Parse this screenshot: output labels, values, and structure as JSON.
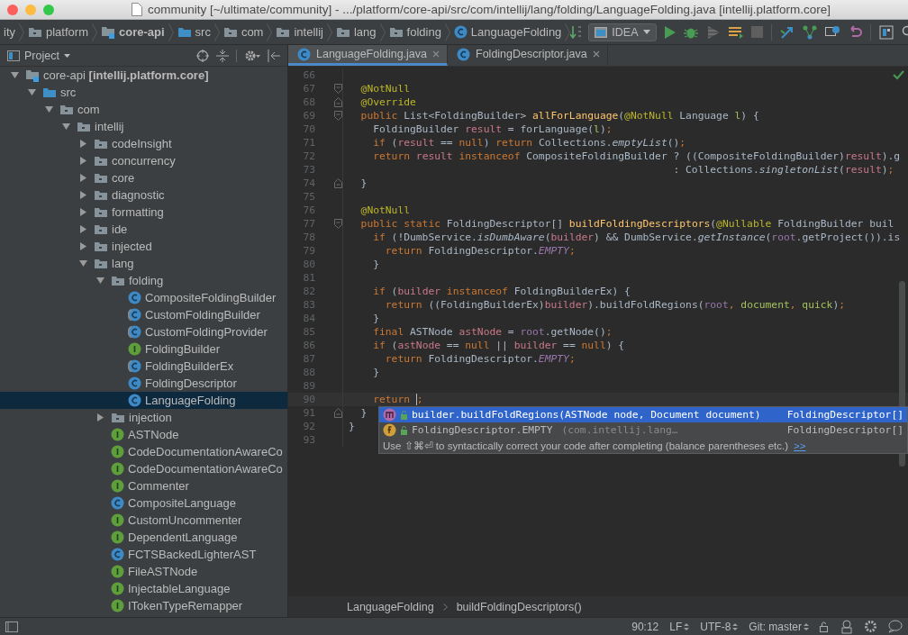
{
  "window": {
    "title": "community [~/ultimate/community] - .../platform/core-api/src/com/intellij/lang/folding/LanguageFolding.java [intellij.platform.core]"
  },
  "navigation_bar": {
    "crumbs": [
      {
        "kind": "plain",
        "label": "ity"
      },
      {
        "kind": "folder",
        "label": "platform"
      },
      {
        "kind": "module",
        "label": "core-api"
      },
      {
        "kind": "source-folder",
        "label": "src"
      },
      {
        "kind": "folder",
        "label": "com"
      },
      {
        "kind": "folder",
        "label": "intellij"
      },
      {
        "kind": "folder",
        "label": "lang"
      },
      {
        "kind": "folder",
        "label": "folding"
      },
      {
        "kind": "class",
        "label": "LanguageFolding"
      }
    ],
    "run_config": "IDEA"
  },
  "project_panel": {
    "title": "Project",
    "items": [
      {
        "kind": "module",
        "label": "core-api **[intellij.platform.core]**",
        "expanded": true,
        "selected": false,
        "children": [
          {
            "kind": "source-folder",
            "label": "src",
            "expanded": true,
            "selected": false,
            "children": [
              {
                "kind": "folder",
                "label": "com",
                "expanded": true,
                "selected": false,
                "children": [
                  {
                    "kind": "folder",
                    "label": "intellij",
                    "expanded": true,
                    "selected": false,
                    "children": [
                      {
                        "kind": "folder",
                        "label": "codeInsight",
                        "expanded": false,
                        "selected": false
                      },
                      {
                        "kind": "folder",
                        "label": "concurrency",
                        "expanded": false,
                        "selected": false
                      },
                      {
                        "kind": "folder",
                        "label": "core",
                        "expanded": false,
                        "selected": false
                      },
                      {
                        "kind": "folder",
                        "label": "diagnostic",
                        "expanded": false,
                        "selected": false
                      },
                      {
                        "kind": "folder",
                        "label": "formatting",
                        "expanded": false,
                        "selected": false
                      },
                      {
                        "kind": "folder",
                        "label": "ide",
                        "expanded": false,
                        "selected": false
                      },
                      {
                        "kind": "folder",
                        "label": "injected",
                        "expanded": false,
                        "selected": false
                      },
                      {
                        "kind": "folder",
                        "label": "lang",
                        "expanded": true,
                        "selected": false,
                        "children": [
                          {
                            "kind": "folder",
                            "label": "folding",
                            "expanded": true,
                            "selected": false,
                            "children": [
                              {
                                "kind": "class",
                                "label": "CompositeFoldingBuilder",
                                "selected": false
                              },
                              {
                                "kind": "abstract-class",
                                "label": "CustomFoldingBuilder",
                                "selected": false
                              },
                              {
                                "kind": "abstract-class",
                                "label": "CustomFoldingProvider",
                                "selected": false
                              },
                              {
                                "kind": "interface",
                                "label": "FoldingBuilder",
                                "selected": false
                              },
                              {
                                "kind": "abstract-class",
                                "label": "FoldingBuilderEx",
                                "selected": false
                              },
                              {
                                "kind": "class",
                                "label": "FoldingDescriptor",
                                "selected": false
                              },
                              {
                                "kind": "class",
                                "label": "LanguageFolding",
                                "selected": true
                              }
                            ]
                          },
                          {
                            "kind": "folder",
                            "label": "injection",
                            "expanded": false,
                            "selected": false
                          },
                          {
                            "kind": "interface",
                            "label": "ASTNode",
                            "selected": false
                          },
                          {
                            "kind": "interface",
                            "label": "CodeDocumentationAwareCo",
                            "selected": false
                          },
                          {
                            "kind": "interface",
                            "label": "CodeDocumentationAwareCo",
                            "selected": false
                          },
                          {
                            "kind": "interface",
                            "label": "Commenter",
                            "selected": false
                          },
                          {
                            "kind": "class",
                            "label": "CompositeLanguage",
                            "selected": false
                          },
                          {
                            "kind": "interface",
                            "label": "CustomUncommenter",
                            "selected": false
                          },
                          {
                            "kind": "interface",
                            "label": "DependentLanguage",
                            "selected": false
                          },
                          {
                            "kind": "class",
                            "label": "FCTSBackedLighterAST",
                            "selected": false
                          },
                          {
                            "kind": "interface",
                            "label": "FileASTNode",
                            "selected": false
                          },
                          {
                            "kind": "interface",
                            "label": "InjectableLanguage",
                            "selected": false
                          },
                          {
                            "kind": "interface",
                            "label": "ITokenTypeRemapper",
                            "selected": false
                          }
                        ]
                      }
                    ]
                  }
                ]
              }
            ]
          }
        ]
      }
    ]
  },
  "editor_tabs": [
    {
      "label": "LanguageFolding.java",
      "selected": true
    },
    {
      "label": "FoldingDescriptor.java",
      "selected": false
    }
  ],
  "code": {
    "lines": [
      {
        "n": "66"
      },
      {
        "n": "67",
        "fold_start": true,
        "tokens": [
          {
            "kind": "annotation",
            "t": "  @NotNull"
          }
        ]
      },
      {
        "n": "68",
        "fold_end": true,
        "tokens": [
          {
            "kind": "annotation",
            "t": "  @Override"
          }
        ]
      },
      {
        "n": "69",
        "fold_start": true,
        "tokens": [
          {
            "kind": "keyword",
            "t": "  public"
          },
          {
            "kind": "plain",
            "t": " List<FoldingBuilder> "
          },
          {
            "kind": "declaration",
            "t": "allForLanguage"
          },
          {
            "kind": "plain",
            "t": "("
          },
          {
            "kind": "annotation",
            "t": "@NotNull"
          },
          {
            "kind": "plain",
            "t": " Language "
          },
          {
            "kind": "parameter",
            "t": "l"
          },
          {
            "kind": "plain",
            "t": ") {"
          }
        ]
      },
      {
        "n": "70",
        "tokens": [
          {
            "kind": "plain",
            "t": "    FoldingBuilder "
          },
          {
            "kind": "local",
            "t": "result"
          },
          {
            "kind": "plain",
            "t": " = forLanguage("
          },
          {
            "kind": "parameter",
            "t": "l"
          },
          {
            "kind": "plain",
            "t": ")"
          },
          {
            "kind": "punctuation",
            "t": ";"
          }
        ]
      },
      {
        "n": "71",
        "tokens": [
          {
            "kind": "keyword",
            "t": "    if"
          },
          {
            "kind": "plain",
            "t": " ("
          },
          {
            "kind": "local",
            "t": "result"
          },
          {
            "kind": "plain",
            "t": " == "
          },
          {
            "kind": "keyword",
            "t": "null"
          },
          {
            "kind": "plain",
            "t": ") "
          },
          {
            "kind": "keyword",
            "t": "return"
          },
          {
            "kind": "plain",
            "t": " Collections."
          },
          {
            "kind": "static",
            "t": "emptyList"
          },
          {
            "kind": "plain",
            "t": "()"
          },
          {
            "kind": "punctuation",
            "t": ";"
          }
        ]
      },
      {
        "n": "72",
        "tokens": [
          {
            "kind": "keyword",
            "t": "    return "
          },
          {
            "kind": "local",
            "t": "result "
          },
          {
            "kind": "keyword",
            "t": "instanceof"
          },
          {
            "kind": "plain",
            "t": " CompositeFoldingBuilder ? ((CompositeFoldingBuilder)"
          },
          {
            "kind": "local",
            "t": "result"
          },
          {
            "kind": "plain",
            "t": ").g"
          }
        ]
      },
      {
        "n": "73",
        "tokens": [
          {
            "kind": "plain",
            "t": "                                                     : Collections."
          },
          {
            "kind": "static",
            "t": "singletonList"
          },
          {
            "kind": "plain",
            "t": "("
          },
          {
            "kind": "local",
            "t": "result"
          },
          {
            "kind": "plain",
            "t": ")"
          },
          {
            "kind": "punctuation",
            "t": ";"
          }
        ]
      },
      {
        "n": "74",
        "fold_end": true,
        "tokens": [
          {
            "kind": "plain",
            "t": "  }"
          }
        ]
      },
      {
        "n": "75"
      },
      {
        "n": "76",
        "tokens": [
          {
            "kind": "annotation",
            "t": "  @NotNull"
          }
        ]
      },
      {
        "n": "77",
        "fold_start": true,
        "tokens": [
          {
            "kind": "keyword",
            "t": "  public static"
          },
          {
            "kind": "plain",
            "t": " FoldingDescriptor[] "
          },
          {
            "kind": "declaration",
            "t": "buildFoldingDescriptors"
          },
          {
            "kind": "plain",
            "t": "("
          },
          {
            "kind": "annotation",
            "t": "@Nullable"
          },
          {
            "kind": "plain",
            "t": " FoldingBuilder buil"
          }
        ]
      },
      {
        "n": "78",
        "tokens": [
          {
            "kind": "keyword",
            "t": "    if"
          },
          {
            "kind": "plain",
            "t": " (!DumbService."
          },
          {
            "kind": "static",
            "t": "isDumbAware"
          },
          {
            "kind": "plain",
            "t": "("
          },
          {
            "kind": "local",
            "t": "builder"
          },
          {
            "kind": "plain",
            "t": ") && DumbService."
          },
          {
            "kind": "static",
            "t": "getInstance"
          },
          {
            "kind": "plain",
            "t": "("
          },
          {
            "kind": "field",
            "t": "root"
          },
          {
            "kind": "plain",
            "t": ".getProject()).is"
          }
        ]
      },
      {
        "n": "79",
        "tokens": [
          {
            "kind": "keyword",
            "t": "      return"
          },
          {
            "kind": "plain",
            "t": " FoldingDescriptor."
          },
          {
            "kind": "constant",
            "t": "EMPTY"
          },
          {
            "kind": "punctuation",
            "t": ";"
          }
        ]
      },
      {
        "n": "80",
        "tokens": [
          {
            "kind": "plain",
            "t": "    }"
          }
        ]
      },
      {
        "n": "81"
      },
      {
        "n": "82",
        "tokens": [
          {
            "kind": "keyword",
            "t": "    if"
          },
          {
            "kind": "plain",
            "t": " ("
          },
          {
            "kind": "local",
            "t": "builder "
          },
          {
            "kind": "keyword",
            "t": "instanceof"
          },
          {
            "kind": "plain",
            "t": " FoldingBuilderEx) {"
          }
        ]
      },
      {
        "n": "83",
        "tokens": [
          {
            "kind": "keyword",
            "t": "      return"
          },
          {
            "kind": "plain",
            "t": " ((FoldingBuilderEx)"
          },
          {
            "kind": "local",
            "t": "builder"
          },
          {
            "kind": "plain",
            "t": ").buildFoldRegions("
          },
          {
            "kind": "field",
            "t": "root"
          },
          {
            "kind": "punctuation",
            "t": ", "
          },
          {
            "kind": "parameter",
            "t": "document"
          },
          {
            "kind": "punctuation",
            "t": ", "
          },
          {
            "kind": "parameter",
            "t": "quick"
          },
          {
            "kind": "plain",
            "t": ")"
          },
          {
            "kind": "punctuation",
            "t": ";"
          }
        ]
      },
      {
        "n": "84",
        "tokens": [
          {
            "kind": "plain",
            "t": "    }"
          }
        ]
      },
      {
        "n": "85",
        "tokens": [
          {
            "kind": "keyword",
            "t": "    final"
          },
          {
            "kind": "plain",
            "t": " ASTNode "
          },
          {
            "kind": "local",
            "t": "astNode"
          },
          {
            "kind": "plain",
            "t": " = "
          },
          {
            "kind": "field",
            "t": "root"
          },
          {
            "kind": "plain",
            "t": ".getNode()"
          },
          {
            "kind": "punctuation",
            "t": ";"
          }
        ]
      },
      {
        "n": "86",
        "tokens": [
          {
            "kind": "keyword",
            "t": "    if"
          },
          {
            "kind": "plain",
            "t": " ("
          },
          {
            "kind": "local",
            "t": "astNode"
          },
          {
            "kind": "plain",
            "t": " == "
          },
          {
            "kind": "keyword",
            "t": "null"
          },
          {
            "kind": "plain",
            "t": " || "
          },
          {
            "kind": "local",
            "t": "builder"
          },
          {
            "kind": "plain",
            "t": " == "
          },
          {
            "kind": "keyword",
            "t": "null"
          },
          {
            "kind": "plain",
            "t": ") {"
          }
        ]
      },
      {
        "n": "87",
        "tokens": [
          {
            "kind": "keyword",
            "t": "      return"
          },
          {
            "kind": "plain",
            "t": " FoldingDescriptor."
          },
          {
            "kind": "constant",
            "t": "EMPTY"
          },
          {
            "kind": "punctuation",
            "t": ";"
          }
        ]
      },
      {
        "n": "88",
        "tokens": [
          {
            "kind": "plain",
            "t": "    }"
          }
        ]
      },
      {
        "n": "89"
      },
      {
        "n": "90",
        "current": true,
        "tokens": [
          {
            "kind": "keyword",
            "t": "    return "
          },
          {
            "kind": "punctuation",
            "t": ";",
            "caret": true
          }
        ]
      },
      {
        "n": "91",
        "fold_end": true,
        "tokens": [
          {
            "kind": "plain",
            "t": "  }"
          }
        ]
      },
      {
        "n": "92",
        "tokens": [
          {
            "kind": "plain",
            "t": "}"
          }
        ]
      },
      {
        "n": "93"
      }
    ]
  },
  "completion": {
    "items": [
      {
        "kind": "method",
        "text": "builder.buildFoldRegions(ASTNode node, Document document)",
        "type": "FoldingDescriptor[]",
        "selected": true
      },
      {
        "kind": "field",
        "text": "FoldingDescriptor.EMPTY",
        "hint": "(com.intellij.lang…",
        "type": "FoldingDescriptor[]",
        "selected": false
      }
    ],
    "tip": "Use ⇧⌘⏎ to syntactically correct your code after completing (balance parentheses etc.)",
    "tip_link": ">>"
  },
  "breadcrumbs": [
    "LanguageFolding",
    "buildFoldingDescriptors()"
  ],
  "status_bar": {
    "items": [
      {
        "kind": "text",
        "label": "90:12"
      },
      {
        "kind": "dropdown",
        "label": "LF"
      },
      {
        "kind": "dropdown",
        "label": "UTF-8"
      },
      {
        "kind": "dropdown",
        "label": "Git: master"
      }
    ]
  }
}
